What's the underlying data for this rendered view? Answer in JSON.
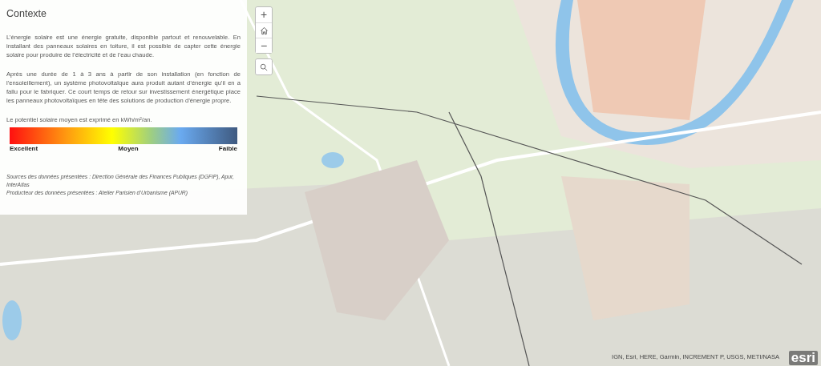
{
  "panel": {
    "title": "Contexte",
    "paragraphs": [
      "L’énergie solaire est une énergie gratuite, disponible partout et renouvelable. En installant des panneaux solaires en toiture, il est possible de capter cette énergie solaire pour produire de l’électricité et de l’eau chaude.",
      "Après une durée de 1 à 3 ans à partir de son installation (en fonction de l’ensoleillement), un système photovoltaïque aura produit autant d’énergie qu’il en a fallu pour le fabriquer. Ce court temps de retour sur investissement énergétique place les panneaux photovoltaïques en tête des solutions de production d’énergie propre."
    ],
    "legend_caption": "Le potentiel solaire moyen est exprimé en kWh/m²/an.",
    "legend_labels": [
      "Excellent",
      "Moyen",
      "Faible"
    ],
    "sources": [
      "Sources des données présentées : Direction Générale des Finances Publiques (DGFiP), Apur, InterAtlas",
      "Producteur des données présentées : Atelier Parisien d’Urbanisme (APUR)"
    ]
  },
  "map": {
    "kind": "picture",
    "controls": [
      {
        "kind": "zoom-in",
        "label": "+"
      },
      {
        "kind": "home"
      },
      {
        "kind": "zoom-out",
        "label": "−"
      },
      {
        "kind": "search"
      }
    ],
    "attribution": "IGN, Esri, HERE, Garmin, INCREMENT P, USGS, METI/NASA",
    "logo": "esri"
  }
}
